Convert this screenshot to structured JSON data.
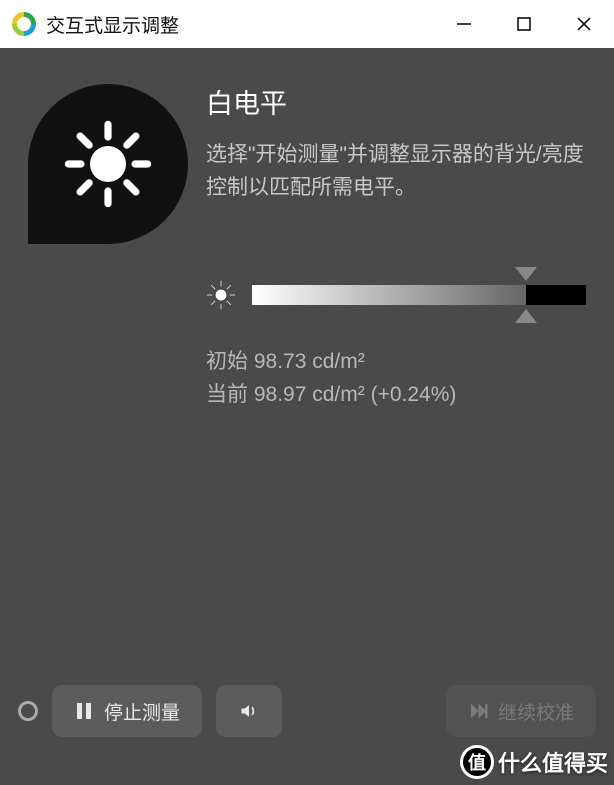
{
  "window": {
    "title": "交互式显示调整"
  },
  "panel": {
    "heading": "白电平",
    "description": "选择\"开始测量\"并调整显示器的背光/亮度控制以匹配所需电平。"
  },
  "slider": {
    "target_percent": 82,
    "current_percent": 82
  },
  "readings": {
    "initial_label": "初始",
    "initial_value": "98.73 cd/m²",
    "current_label": "当前",
    "current_value": "98.97 cd/m²",
    "delta": "(+0.24%)"
  },
  "buttons": {
    "stop_measure": "停止测量",
    "continue_calib": "继续校准"
  },
  "watermark": {
    "badge": "值",
    "text": "什么值得买"
  }
}
